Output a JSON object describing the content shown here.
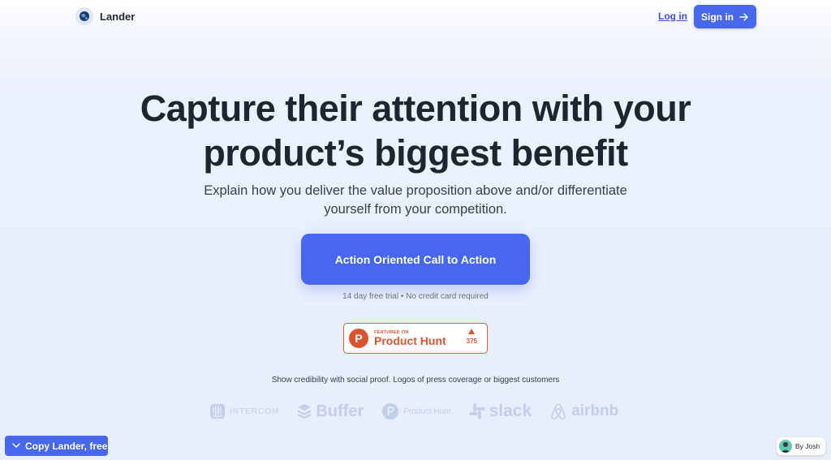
{
  "nav": {
    "brand_name": "Lander",
    "login_label": "Log in",
    "signin_label": "Sign in"
  },
  "hero": {
    "headline_line1": "Capture their attention with your",
    "headline_line2": "product’s biggest benefit",
    "sub_line1": "Explain how you deliver the value proposition above and/or differentiate",
    "sub_line2": "yourself from your competition.",
    "cta_label": "Action Oriented Call to Action",
    "cta_note": "14 day free trial • No credit card required"
  },
  "producthunt_badge": {
    "featured_label": "FEATURED ON",
    "name": "Product Hunt",
    "votes": "375"
  },
  "social_proof": {
    "text": "Show credibility with social proof. Logos of press coverage or biggest customers",
    "logos": [
      "INTERCOM",
      "Buffer",
      "Product Hunt",
      "slack",
      "airbnb"
    ]
  },
  "footer": {
    "copy_label": "Copy Lander, free",
    "byline": "By Josh"
  },
  "colors": {
    "accent": "#4767ee",
    "producthunt": "#da552f",
    "logo_muted": "#c3cdec"
  }
}
